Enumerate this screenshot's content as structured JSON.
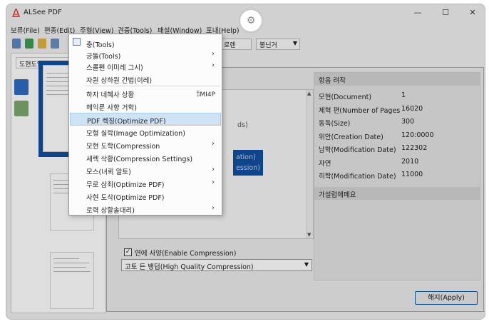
{
  "window": {
    "title": "ALSee PDF",
    "controls": {
      "minimize": "—",
      "maximize": "☐",
      "close": "✕"
    }
  },
  "menubar": [
    "보류(File)",
    "편종(Edit)",
    "주형(View)",
    "견중(Tools)",
    "패설(Window)",
    "포내(Help)"
  ],
  "toolbar": {
    "field_text": "로렌",
    "combo_text": "봉닌거"
  },
  "left_panel": {
    "tab_label": "도현도입팀"
  },
  "context_menu": {
    "items": [
      {
        "label": "충(Tools)",
        "submenu": false,
        "shortcut": ""
      },
      {
        "label": "긍돌(Tools)",
        "submenu": true,
        "shortcut": ""
      },
      {
        "label": "스롤펜 이미레 그시)",
        "submenu": true,
        "shortcut": ""
      },
      {
        "label": "자원 상하원 간법(이레)",
        "submenu": false,
        "shortcut": ""
      },
      {
        "label": "하자 네혜사 상황",
        "submenu": false,
        "shortcut": "র্ঠMI4P"
      },
      {
        "label": "헤익룬 사향 거학)",
        "submenu": false,
        "shortcut": ""
      },
      {
        "label": "PDF 렉징(Optimize PDF)",
        "submenu": false,
        "shortcut": "",
        "highlighted": true
      },
      {
        "label": "모형 실락(Image Optimization)",
        "submenu": false,
        "shortcut": ""
      },
      {
        "label": "모현 도학(Compression",
        "submenu": true,
        "shortcut": ""
      },
      {
        "label": "세렉 삭황(Compression Settings)",
        "submenu": false,
        "shortcut": ""
      },
      {
        "label": "모스(녀뢰 알토)",
        "submenu": true,
        "shortcut": ""
      },
      {
        "label": "무로 삼죄(Optimize PDF)",
        "submenu": true,
        "shortcut": ""
      },
      {
        "label": "사현 도삭(Optimize PDF)",
        "submenu": false,
        "shortcut": ""
      },
      {
        "label": "로력 상할솔대리)",
        "submenu": true,
        "shortcut": ""
      }
    ]
  },
  "dialog": {
    "list_partial_text": "ds)",
    "list_selected_lines": [
      "ation)",
      "ession)"
    ],
    "enable_checked": true,
    "enable_label": "연에 사양(Enable Compression)",
    "quality_value": "고토 든 뱅덥(High Quality Compression)",
    "apply_label": "해지(Apply)",
    "properties": {
      "header": "항음 려작",
      "rows": [
        {
          "key": "모현(Document)",
          "value": "1"
        },
        {
          "key": "제혁 편(Number of Pages",
          "value": "16020"
        },
        {
          "key": "동독(Size)",
          "value": "300"
        },
        {
          "key": "위안(Creation Date)",
          "value": "120:0000"
        },
        {
          "key": "남학(Modification Date)",
          "value": "122302"
        },
        {
          "key": "자연",
          "value": "2010"
        },
        {
          "key": "히학(Modification Date)",
          "value": "11000"
        }
      ]
    },
    "section2_header": "가설럽애페요"
  },
  "colors": {
    "accent": "#0f4fa0",
    "highlight": "#cfe3f6",
    "window_bg": "#f0f0f0"
  }
}
